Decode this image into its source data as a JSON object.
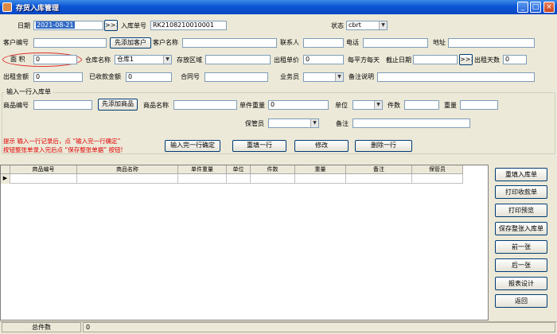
{
  "window": {
    "title": "存货入库管理",
    "minimize": "_",
    "maximize": "□",
    "close": "×"
  },
  "header": {
    "date_label": "日期",
    "date_value": "2021-08-21",
    "date_btn": ">>>",
    "inbound_no_label": "入库单号",
    "inbound_no_value": "RK2108210010001",
    "status_label": "状态",
    "status_value": "cbrt",
    "customer_no_label": "客户编号",
    "customer_no_value": "",
    "add_customer_btn": "先添加客户",
    "customer_name_label": "客户名称",
    "customer_name_value": "",
    "contact_label": "联系人",
    "contact_value": "",
    "phone_label": "电话",
    "phone_value": "",
    "address_label": "地址",
    "address_value": "",
    "area_label": "面  积",
    "area_value": "0",
    "warehouse_label": "仓库名称",
    "warehouse_value": "仓库1",
    "storage_area_label": "存放区域",
    "storage_area_value": "",
    "rent_price_label": "出租单价",
    "rent_price_value": "0",
    "per_sqm_label": "每平方每天",
    "deadline_label": "截止日期",
    "deadline_value": "",
    "deadline_btn": ">>>",
    "rent_days_label": "出租天数",
    "rent_days_value": "0",
    "rent_amount_label": "出租金额",
    "rent_amount_value": "0",
    "received_label": "已收款金额",
    "received_value": "0",
    "contract_label": "合同号",
    "contract_value": "",
    "salesman_label": "业务员",
    "salesman_value": "",
    "remark_label": "备注说明",
    "remark_value": ""
  },
  "line_entry": {
    "group_title": "输入一行入库单",
    "product_no_label": "商品编号",
    "product_no_value": "",
    "add_product_btn": "先添加商品",
    "product_name_label": "商品名称",
    "product_name_value": "",
    "unit_weight_label": "单件重量",
    "unit_weight_value": "0",
    "unit_label": "单位",
    "unit_value": "",
    "qty_label": "件数",
    "qty_value": "",
    "weight_label": "重量",
    "weight_value": "",
    "keeper_label": "保管员",
    "keeper_value": "",
    "note_label": "备注",
    "note_value": "",
    "hint_line1": "提示  输入一行记录后，点 “输入完一行确定”",
    "hint_line2": "按钮整张单录入完后点 “保存整张单据” 按钮!",
    "confirm_btn": "输入完一行确定",
    "refill_btn": "重填一行",
    "modify_btn": "修改",
    "delete_btn": "删除一行"
  },
  "grid": {
    "columns": [
      "商品编号",
      "商品名称",
      "单件重量",
      "单位",
      "件数",
      "重量",
      "备注",
      "保管员"
    ],
    "row_indicator": "▶"
  },
  "side_buttons": [
    "重填入库单",
    "打印收款单",
    "打印预览",
    "保存整张入库单",
    "前一张",
    "后一张",
    "报表设计",
    "返回"
  ],
  "status_bar": {
    "total_label": "总件数",
    "total_value": "0"
  }
}
